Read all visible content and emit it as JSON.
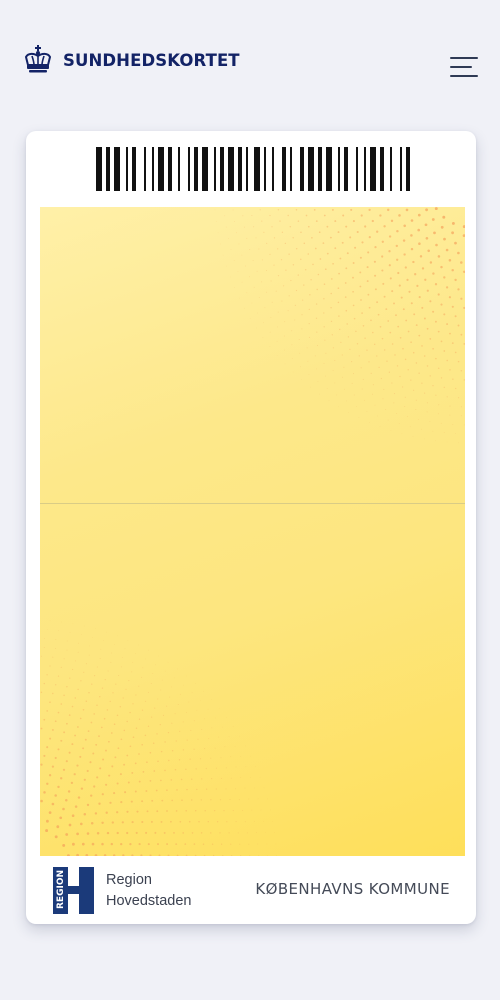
{
  "header": {
    "brand_name": "SUNDHEDSKORTET",
    "logo_icon": "crown-icon",
    "menu_icon": "hamburger-menu-icon"
  },
  "card": {
    "barcode_icon": "barcode-icon",
    "background_color": "#fde67f",
    "region_logo": {
      "vertical_text": "REGION",
      "icon": "region-hovedstaden-logo"
    },
    "region_name_line1": "Region",
    "region_name_line2": "Hovedstaden",
    "municipality": "KØBENHAVNS KOMMUNE"
  },
  "colors": {
    "brand_navy": "#132366",
    "page_background": "#f0f1f7",
    "card_yellow": "#fde67f",
    "dot_orange": "#f4a05a"
  }
}
